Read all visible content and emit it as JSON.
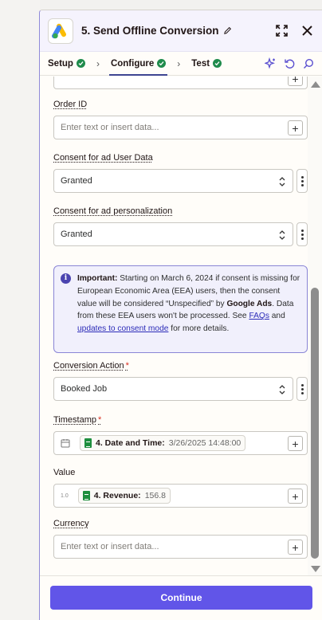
{
  "header": {
    "title": "5. Send Offline Conversion",
    "app_icon": "google-ads-logo"
  },
  "tabs": [
    {
      "label": "Setup",
      "status": "complete"
    },
    {
      "label": "Configure",
      "status": "complete",
      "active": true
    },
    {
      "label": "Test",
      "status": "complete"
    }
  ],
  "fields": {
    "order_id": {
      "label": "Order ID",
      "placeholder": "Enter text or insert data..."
    },
    "consent_user_data": {
      "label": "Consent for ad User Data",
      "value": "Granted"
    },
    "consent_personalization": {
      "label": "Consent for ad personalization",
      "value": "Granted"
    },
    "conversion_action": {
      "label": "Conversion Action",
      "required_mark": "*",
      "value": "Booked Job"
    },
    "timestamp": {
      "label": "Timestamp",
      "required_mark": "*",
      "pill_label": "4. Date and Time:",
      "pill_value": "3/26/2025 14:48:00"
    },
    "value": {
      "label": "Value",
      "type_hint": "1.0",
      "pill_label": "4. Revenue:",
      "pill_value": "156.8"
    },
    "currency": {
      "label": "Currency",
      "placeholder": "Enter text or insert data..."
    }
  },
  "notice": {
    "strong": "Important:",
    "text1": " Starting on March 6, 2024 if consent is missing for European Economic Area (EEA) users, then the consent value will be considered “Unspecified” by ",
    "brand": "Google Ads",
    "text2": ". Data from these EEA users won't be processed. See ",
    "link1": "FAQs",
    "text3": " and ",
    "link2": "updates to consent mode",
    "text4": " for more details."
  },
  "footer": {
    "continue_label": "Continue"
  },
  "colors": {
    "accent": "#6155e8",
    "success": "#1f8b4c",
    "notice_border": "#8a85d6"
  }
}
